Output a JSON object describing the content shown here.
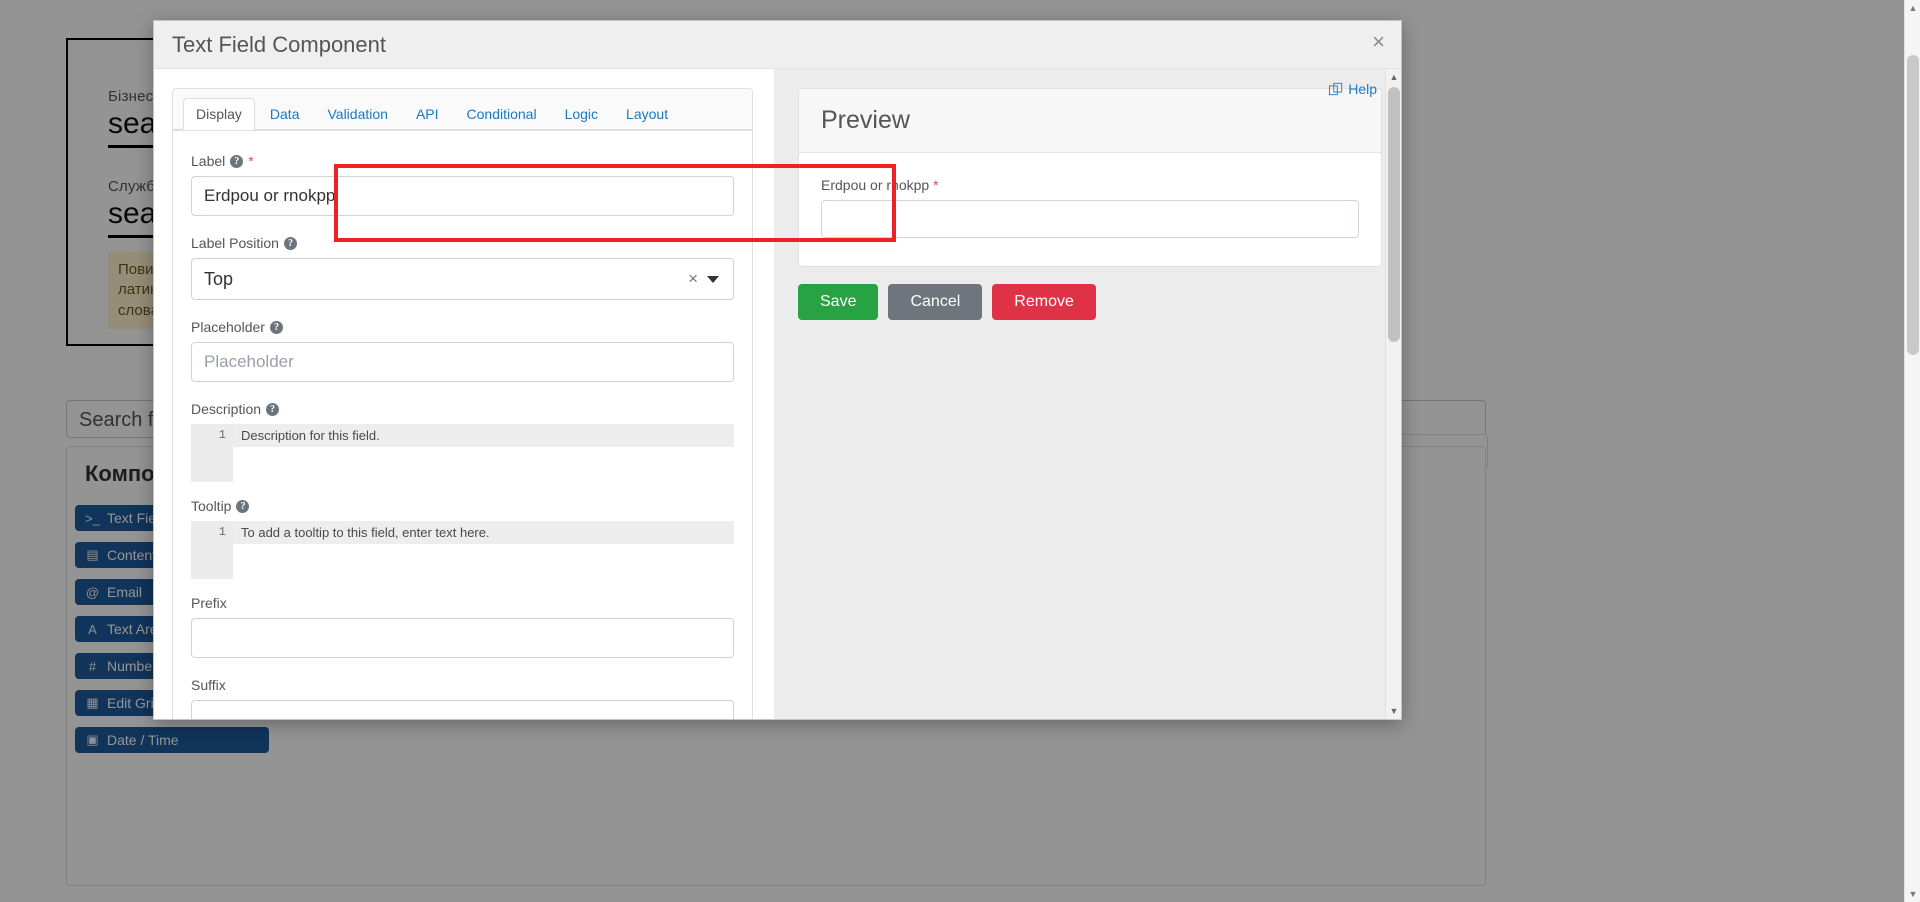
{
  "background": {
    "card_fields": [
      {
        "label": "Бізнес-назва",
        "value": "search"
      },
      {
        "label": "Службова назва",
        "value": "search"
      }
    ],
    "hint": "Повинна містити лише символи латиниці та закінчуватись в кінці слова",
    "search_placeholder": "Search fields",
    "panel_title": "Компоненти",
    "components": [
      {
        "icon": ">_",
        "label": "Text Field"
      },
      {
        "icon": "▤",
        "label": "Content"
      },
      {
        "icon": "@",
        "label": "Email"
      },
      {
        "icon": "A",
        "label": "Text Area"
      },
      {
        "icon": "#",
        "label": "Number"
      },
      {
        "icon": "▦",
        "label": "Edit Grid"
      },
      {
        "icon": "▣",
        "label": "Date / Time"
      }
    ]
  },
  "modal": {
    "title": "Text Field Component",
    "close_icon": "×",
    "help_label": "Help",
    "help_icon": "external-link-icon",
    "tabs": [
      {
        "label": "Display",
        "active": true
      },
      {
        "label": "Data",
        "active": false
      },
      {
        "label": "Validation",
        "active": false
      },
      {
        "label": "API",
        "active": false
      },
      {
        "label": "Conditional",
        "active": false
      },
      {
        "label": "Logic",
        "active": false
      },
      {
        "label": "Layout",
        "active": false
      }
    ],
    "fields": {
      "label": {
        "title": "Label",
        "required_marker": "*",
        "help_icon": "?",
        "value": "Erdpou or rnokpp"
      },
      "label_position": {
        "title": "Label Position",
        "help_icon": "?",
        "value": "Top",
        "clear_icon": "×",
        "caret_icon": "▼"
      },
      "placeholder": {
        "title": "Placeholder",
        "help_icon": "?",
        "value": "",
        "placeholder": "Placeholder"
      },
      "description": {
        "title": "Description",
        "help_icon": "?",
        "line_number": "1",
        "placeholder": "Description for this field."
      },
      "tooltip": {
        "title": "Tooltip",
        "help_icon": "?",
        "line_number": "1",
        "placeholder": "To add a tooltip to this field, enter text here."
      },
      "prefix": {
        "title": "Prefix",
        "value": ""
      },
      "suffix": {
        "title": "Suffix",
        "value": ""
      }
    },
    "preview": {
      "title": "Preview",
      "field_label": "Erdpou or rnokpp",
      "required_marker": "*",
      "input_value": ""
    },
    "actions": {
      "save": "Save",
      "cancel": "Cancel",
      "remove": "Remove"
    }
  },
  "colors": {
    "highlight": "#ee2226",
    "save": "#27a343",
    "cancel": "#6e757c",
    "remove": "#e03247",
    "link": "#1979c3",
    "required": "#d9534f"
  }
}
